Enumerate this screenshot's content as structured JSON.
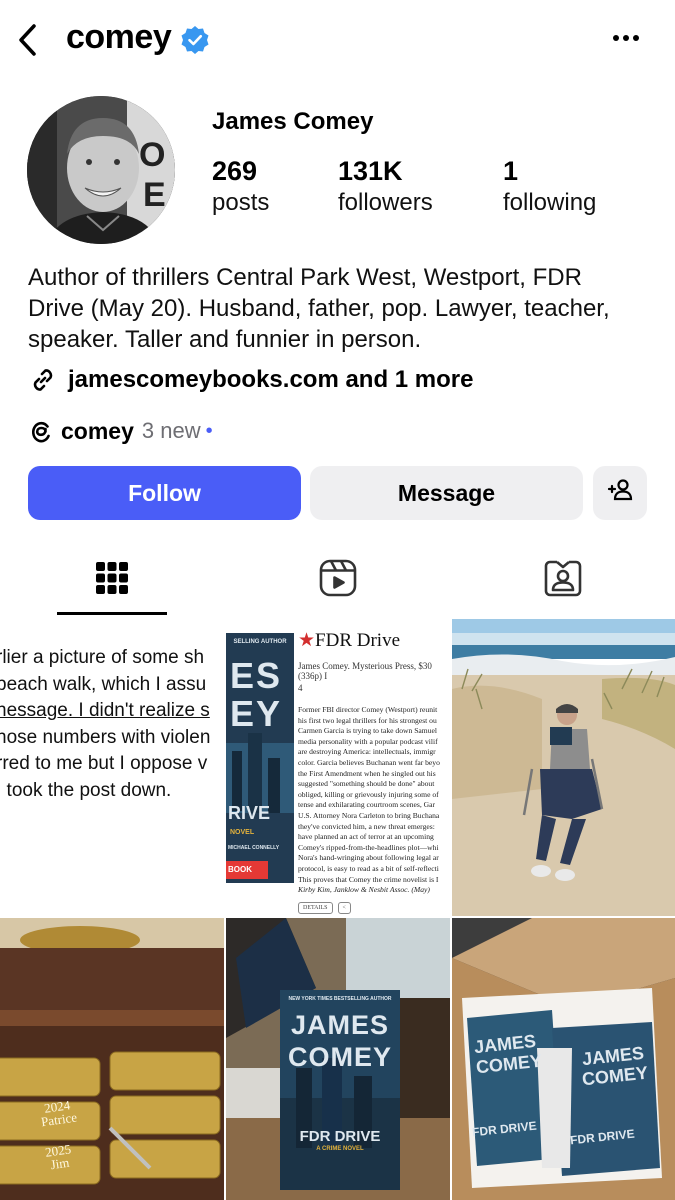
{
  "header": {
    "username": "comey"
  },
  "profile": {
    "display_name": "James Comey",
    "stats": [
      {
        "value": "269",
        "label": "posts"
      },
      {
        "value": "131K",
        "label": "followers"
      },
      {
        "value": "1",
        "label": "following"
      }
    ],
    "bio_lines": [
      "Author of thrillers Central Park West, Westport, FDR",
      "Drive (May 20). Husband, father, pop. Lawyer, teacher,",
      "speaker. Taller and funnier in person."
    ],
    "link_text": "jamescomeybooks.com and 1 more",
    "threads": {
      "name": "comey",
      "new_label": "3 new",
      "dot": "•"
    }
  },
  "actions": {
    "follow_label": "Follow",
    "message_label": "Message"
  },
  "tabs": [
    "grid",
    "reels",
    "tagged"
  ],
  "colors": {
    "accent": "#4a5df7",
    "secondary_button": "#efeff1",
    "verified": "#3897f0",
    "muted_text": "#6e6e73"
  },
  "posts": {
    "text_post_lines": [
      "rlier a picture of some sh",
      "beach walk, which I assu",
      "nessage. I didn't realize s",
      "hose numbers with violen",
      "rred to me but I oppose v",
      " I took the post down."
    ],
    "review": {
      "star": "★",
      "title": "FDR Drive",
      "meta": "James Comey. Mysterious Press, $30 (336p) I",
      "page": "4",
      "body_lines": [
        "Former FBI director Comey (Westport) reunit",
        "his first two legal thrillers for his strongest ou",
        "Carmen Garcia is trying to take down Samuel",
        "media personality with a popular podcast vilif",
        "are destroying America: intellectuals, immigr",
        "color. Garcia believes Buchanan went far beyo",
        "the First Amendment when he singled out his",
        "suggested \"something should be done\" about",
        "obliged, killing or grievously injuring some of",
        "tense and exhilarating courtroom scenes, Gar",
        "U.S. Attorney Nora Carleton to bring Buchana",
        "they've convicted him, a new threat emerges:",
        "have planned an act of terror at an upcoming",
        "Comey's ripped-from-the-headlines plot—whi",
        "Nora's hand-wringing about following legal ar",
        "protocol, is easy to read as a bit of self-reflecti",
        "This proves that Comey the crime novelist is I",
        "Kirby Kim, Janklow & Nesbit Assoc. (May)"
      ],
      "details_label": "DETAILS",
      "book_cover_top": "SELLING AUTHOR",
      "book_cover_title_1": "ES",
      "book_cover_title_2": "EY",
      "book_cover_sub": "RIVE",
      "book_cover_novel": "NOVEL",
      "book_cover_blurb": "MICHAEL CONNELLY",
      "book_cover_button": "BOOK"
    },
    "plaques": [
      {
        "year": "2024",
        "name": "Patrice"
      },
      {
        "year": "2025",
        "name": "Jim"
      }
    ],
    "book_photo": {
      "top": "NEW YORK TIMES BESTSELLING AUTHOR",
      "title_1": "JAMES",
      "title_2": "COMEY",
      "subtitle": "FDR DRIVE",
      "tag": "A CRIME NOVEL"
    },
    "box_photo": {
      "title_1": "JAMES",
      "title_2": "COMEY",
      "subtitle": "FDR DRIVE"
    }
  }
}
